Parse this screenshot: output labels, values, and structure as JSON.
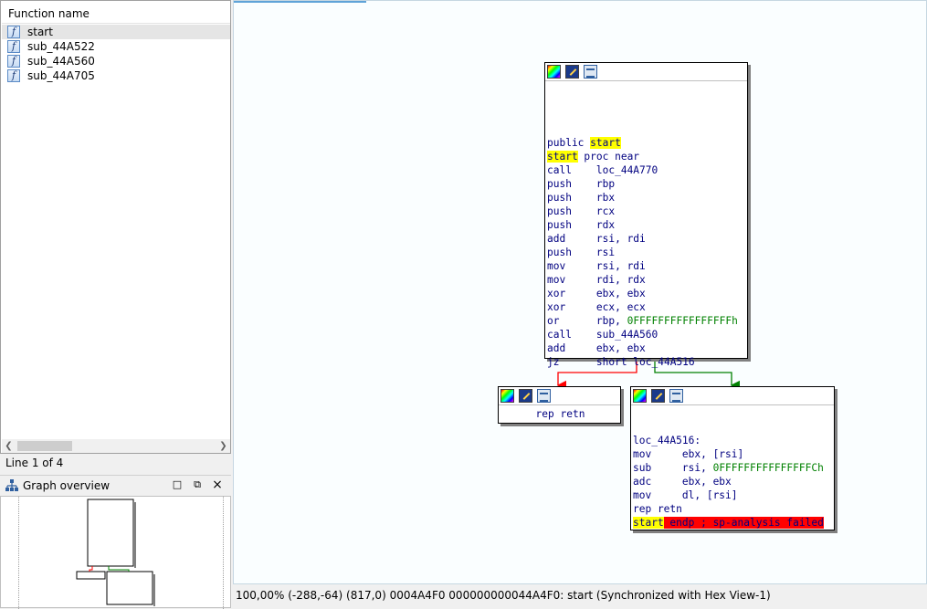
{
  "function_list": {
    "header": "Function name",
    "items": [
      {
        "name": "start",
        "selected": true
      },
      {
        "name": "sub_44A522"
      },
      {
        "name": "sub_44A560"
      },
      {
        "name": "sub_44A705"
      }
    ],
    "line_status": "Line 1 of 4"
  },
  "graph_overview": {
    "title": "Graph overview"
  },
  "nodes": {
    "main": {
      "header": "public start",
      "lines": [
        {
          "mn": "start proc near",
          "op": ""
        },
        {
          "mn": "call",
          "op": "loc_44A770"
        },
        {
          "mn": "push",
          "op": "rbp"
        },
        {
          "mn": "push",
          "op": "rbx"
        },
        {
          "mn": "push",
          "op": "rcx"
        },
        {
          "mn": "push",
          "op": "rdx"
        },
        {
          "mn": "add",
          "op": "rsi, rdi"
        },
        {
          "mn": "push",
          "op": "rsi"
        },
        {
          "mn": "mov",
          "op": "rsi, rdi"
        },
        {
          "mn": "mov",
          "op": "rdi, rdx"
        },
        {
          "mn": "xor",
          "op": "ebx, ebx"
        },
        {
          "mn": "xor",
          "op": "ecx, ecx"
        },
        {
          "mn": "or",
          "op": "rbp, 0FFFFFFFFFFFFFFFFh"
        },
        {
          "mn": "call",
          "op": "sub_44A560"
        },
        {
          "mn": "add",
          "op": "ebx, ebx"
        },
        {
          "mn": "jz",
          "op": "short loc_44A516"
        }
      ]
    },
    "left": {
      "line": "rep retn"
    },
    "right": {
      "label": "loc_44A516:",
      "lines": [
        {
          "mn": "mov",
          "op": "ebx, [rsi]"
        },
        {
          "mn": "sub",
          "op": "rsi, 0FFFFFFFFFFFFFFFCh"
        },
        {
          "mn": "adc",
          "op": "ebx, ebx"
        },
        {
          "mn": "mov",
          "op": "dl, [rsi]"
        },
        {
          "mn": "rep retn",
          "op": ""
        }
      ],
      "endline": "start endp ; sp-analysis failed"
    }
  },
  "status_bar": "100,00% (-288,-64) (817,0) 0004A4F0 000000000044A4F0: start (Synchronized with Hex View-1)",
  "colors": {
    "code_text": "#000080",
    "highlight": "#ffff00",
    "error_bg": "#ff0000",
    "branch_true": "#008000",
    "branch_false": "#ff0000"
  }
}
